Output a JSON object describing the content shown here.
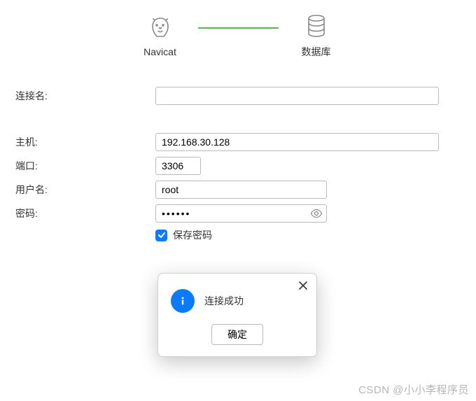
{
  "header": {
    "left_label": "Navicat",
    "right_label": "数据库"
  },
  "form": {
    "connection_name_label": "连接名:",
    "connection_name_value": "",
    "host_label": "主机:",
    "host_value": "192.168.30.128",
    "port_label": "端口:",
    "port_value": "3306",
    "username_label": "用户名:",
    "username_value": "root",
    "password_label": "密码:",
    "password_value": "••••••",
    "save_password_label": "保存密码",
    "save_password_checked": true
  },
  "dialog": {
    "message": "连接成功",
    "ok_label": "确定"
  },
  "watermark": "CSDN @小小李程序员"
}
